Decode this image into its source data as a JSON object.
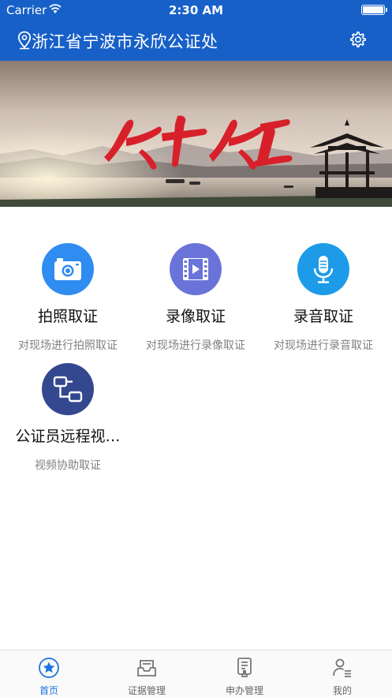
{
  "status_bar": {
    "carrier": "Carrier",
    "time": "2:30 AM"
  },
  "nav": {
    "title": "浙江省宁波市永欣公证处",
    "location_icon": "location-pin-icon",
    "settings_icon": "gear-icon"
  },
  "banner": {
    "calligraphy": "公平公正"
  },
  "features": [
    {
      "label": "拍照取证",
      "desc": "对现场进行拍照取证",
      "icon": "camera-icon",
      "color": "#2f8cf0"
    },
    {
      "label": "录像取证",
      "desc": "对现场进行录像取证",
      "icon": "video-film-icon",
      "color": "#6a74d8"
    },
    {
      "label": "录音取证",
      "desc": "对现场进行录音取证",
      "icon": "microphone-icon",
      "color": "#1d9be8"
    },
    {
      "label": "公证员远程视…",
      "desc": "视频协助取证",
      "icon": "remote-link-icon",
      "color": "#33488f"
    }
  ],
  "tabs": [
    {
      "label": "首页",
      "icon": "star-circle-icon",
      "active": true
    },
    {
      "label": "证据管理",
      "icon": "inbox-tray-icon",
      "active": false
    },
    {
      "label": "申办管理",
      "icon": "document-stamp-icon",
      "active": false
    },
    {
      "label": "我的",
      "icon": "user-list-icon",
      "active": false
    }
  ],
  "colors": {
    "primary": "#1760c8",
    "tab_active": "#1a73e0"
  }
}
